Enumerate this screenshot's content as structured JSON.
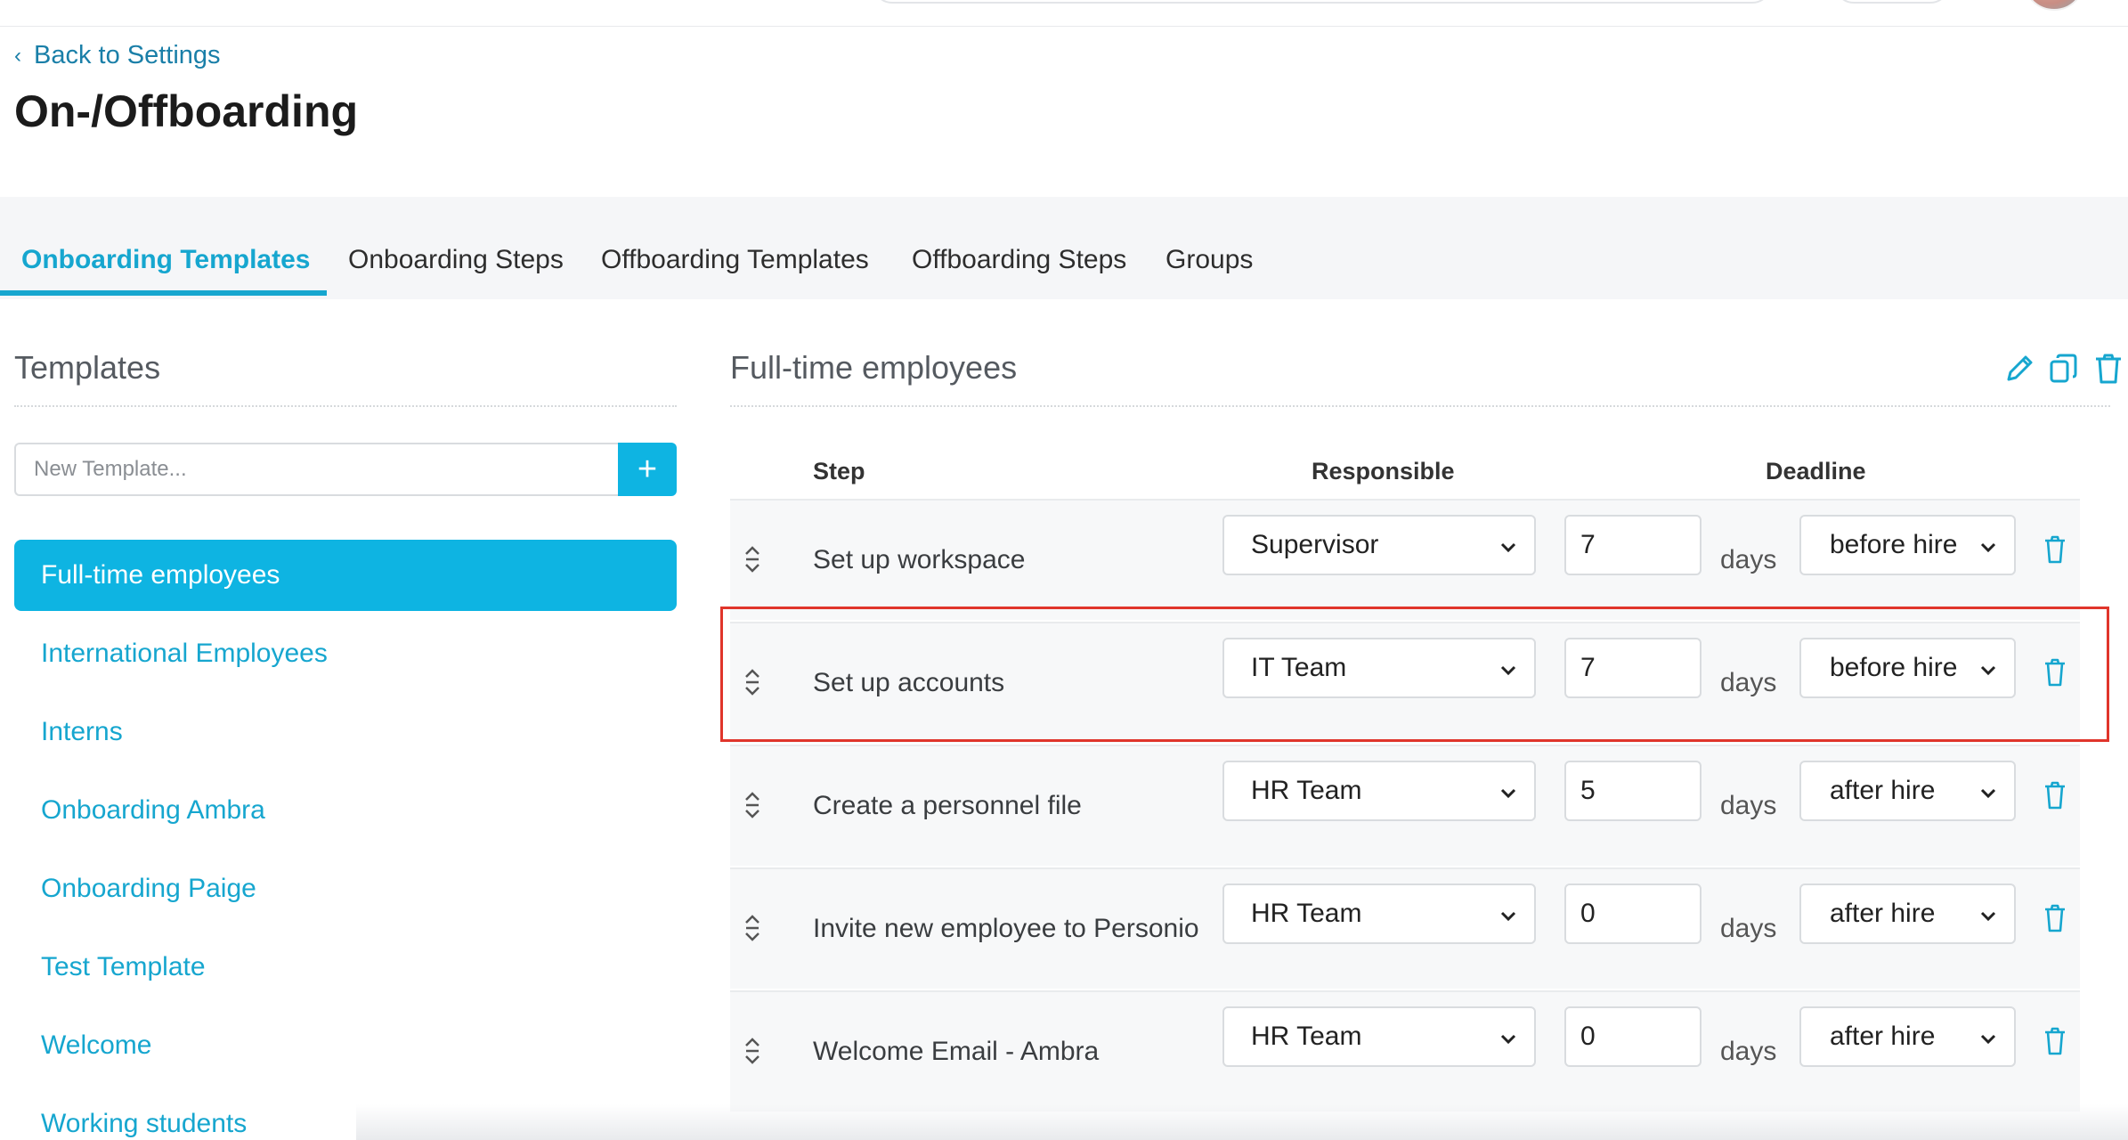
{
  "header": {
    "back_label": "Back to Settings",
    "page_title": "On-/Offboarding"
  },
  "tabs": [
    {
      "label": "Onboarding Templates",
      "active": true
    },
    {
      "label": "Onboarding Steps",
      "active": false
    },
    {
      "label": "Offboarding Templates",
      "active": false
    },
    {
      "label": "Offboarding Steps",
      "active": false
    },
    {
      "label": "Groups",
      "active": false
    }
  ],
  "left": {
    "title": "Templates",
    "new_template_placeholder": "New Template...",
    "add_button": "+",
    "templates": [
      {
        "label": "Full-time employees",
        "selected": true
      },
      {
        "label": "International Employees"
      },
      {
        "label": "Interns"
      },
      {
        "label": "Onboarding Ambra"
      },
      {
        "label": "Onboarding Paige"
      },
      {
        "label": "Test Template"
      },
      {
        "label": "Welcome"
      },
      {
        "label": "Working students"
      }
    ]
  },
  "right": {
    "title": "Full-time employees",
    "actions": [
      "pencil-icon",
      "copy-icon",
      "trash-icon"
    ],
    "columns": {
      "step": "Step",
      "responsible": "Responsible",
      "deadline": "Deadline"
    },
    "days_label": "days",
    "rows": [
      {
        "step": "Set up workspace",
        "responsible": "Supervisor",
        "days": "7",
        "when": "before hire"
      },
      {
        "step": "Set up accounts",
        "responsible": "IT Team",
        "days": "7",
        "when": "before hire",
        "highlighted": true
      },
      {
        "step": "Create a personnel file",
        "responsible": "HR Team",
        "days": "5",
        "when": "after hire"
      },
      {
        "step": "Invite new employee to Personio",
        "responsible": "HR Team",
        "days": "0",
        "when": "after hire"
      },
      {
        "step": "Welcome Email - Ambra",
        "responsible": "HR Team",
        "days": "0",
        "when": "after hire"
      }
    ]
  },
  "colors": {
    "accent": "#0eb4e2",
    "link": "#16a6cf",
    "highlight_border": "#e0352b"
  }
}
